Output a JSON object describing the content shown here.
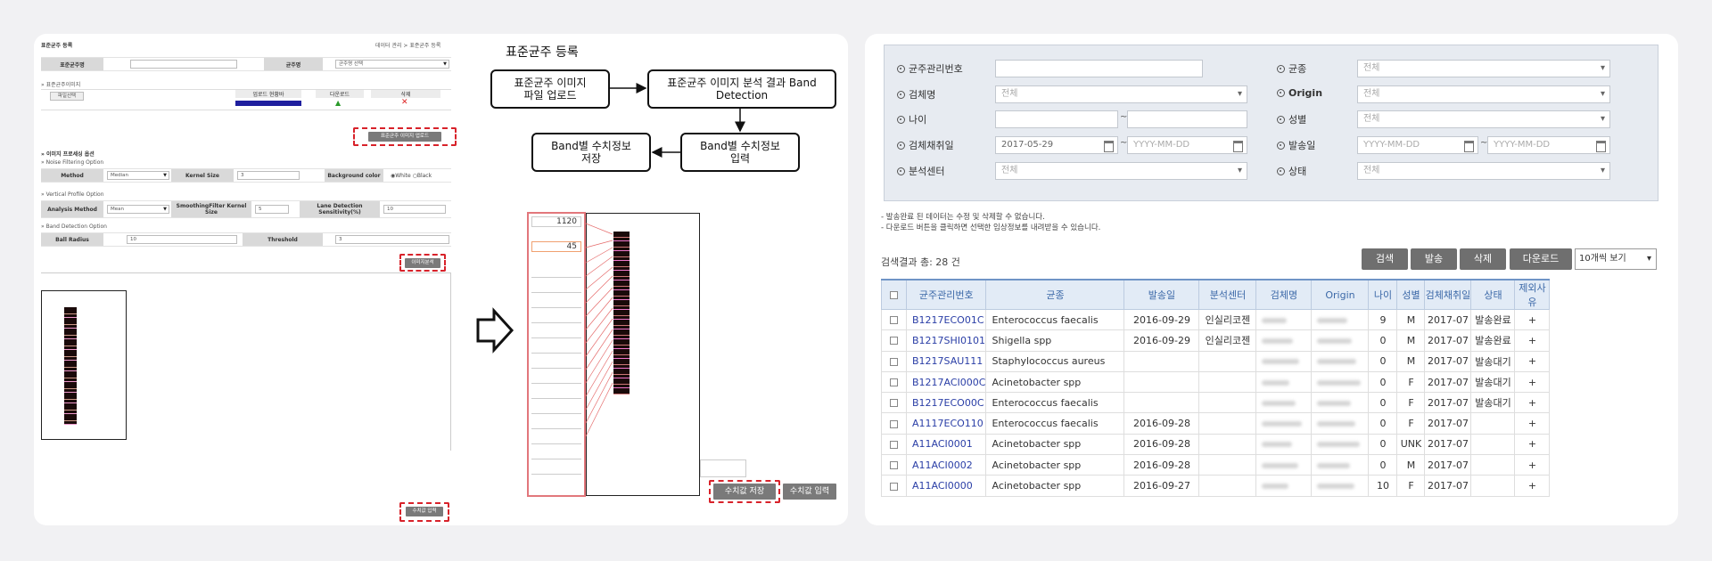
{
  "left_form": {
    "title": "표준균주 등록",
    "breadcrumb": "데이터 관리 > 표준균주 등록",
    "strain_name_label": "표준균주명",
    "strain_label": "균주명",
    "strain_select": "균주명 선택",
    "image_section": "» 표준균주이미지",
    "file_button": "파일선택",
    "cols": {
      "upload_status": "업로드 현황바",
      "download": "다운로드",
      "delete": "삭제"
    },
    "upload_button": "표준균주 이미지 업로드",
    "preprocess_section": "» 이미지 프로세싱 옵션",
    "noise_section": "» Noise Filtering Option",
    "method_label": "Method",
    "method_value": "Median",
    "kernel_label": "Kernel Size",
    "kernel_value": "3",
    "bg_label": "Background color",
    "bg_options": "◉White ○Black",
    "vertical_section": "» Vertical Profile Option",
    "analysis_label": "Analysis Method",
    "analysis_value": "Mean",
    "smoothing_label": "SmoothingFilter Kernel Size",
    "smoothing_value": "5",
    "lane_label": "Lane Detection Sensitivity(%)",
    "lane_value": "10",
    "band_section": "» Band Detection Option",
    "ball_label": "Ball Radius",
    "ball_value": "10",
    "threshold_label": "Threshold",
    "threshold_value": "3",
    "analyze_button": "이미지분석",
    "save_button": "수치값 입력"
  },
  "flow": {
    "title": "표준균주 등록",
    "step1": "표준균주 이미지\n파일 업로드",
    "step2": "표준균주 이미지 분석 결과 Band\nDetection",
    "step3": "Band별 수치정보\n입력",
    "step4": "Band별 수치정보\n저장"
  },
  "band_panel": {
    "value1": "1120",
    "value2": "45",
    "save_button": "수치값 저장",
    "input_button": "수치값 입력"
  },
  "search": {
    "mgmt_no_label": "균주관리번호",
    "species_label": "균종",
    "species_value": "전체",
    "specimen_label": "검체명",
    "specimen_value": "전체",
    "origin_label": "Origin",
    "origin_value": "전체",
    "age_label": "나이",
    "sex_label": "성별",
    "sex_value": "전체",
    "collect_label": "검체채취일",
    "collect_from": "2017-05-29",
    "collect_to": "YYYY-MM-DD",
    "send_label": "발송일",
    "send_from": "YYYY-MM-DD",
    "send_to": "YYYY-MM-DD",
    "center_label": "분석센터",
    "center_value": "전체",
    "status_label": "상태",
    "status_value": "전체",
    "tilde": "~"
  },
  "notes": [
    "- 발송완료 된 데이터는 수정 및 삭제할 수 없습니다.",
    "- 다운로드 버튼을 클릭하면 선택한 임상정보를 내려받을 수 있습니다."
  ],
  "result_count": "검색결과 총: 28 건",
  "actions": {
    "search": "검색",
    "send": "발송",
    "delete": "삭제",
    "download": "다운로드",
    "page_size": "10개씩 보기"
  },
  "table": {
    "headers": [
      "균주관리번호",
      "균종",
      "발송일",
      "분석센터",
      "검체명",
      "Origin",
      "나이",
      "성별",
      "검체채취일",
      "상태",
      "제외사유"
    ],
    "rows": [
      [
        "B1217ECO01C",
        "Enterococcus faecalis",
        "2016-09-29",
        "인실리코젠",
        "9",
        "M",
        "2017-07",
        "발송완료",
        "+"
      ],
      [
        "B1217SHI0101",
        "Shigella spp",
        "2016-09-29",
        "인실리코젠",
        "0",
        "M",
        "2017-07",
        "발송완료",
        "+"
      ],
      [
        "B1217SAU111",
        "Staphylococcus aureus",
        "",
        "",
        "0",
        "M",
        "2017-07",
        "발송대기",
        "+"
      ],
      [
        "B1217ACI000C",
        "Acinetobacter spp",
        "",
        "",
        "0",
        "F",
        "2017-07",
        "발송대기",
        "+"
      ],
      [
        "B1217ECO00C",
        "Enterococcus faecalis",
        "",
        "",
        "0",
        "F",
        "2017-07",
        "발송대기",
        "+"
      ],
      [
        "A1117ECO110",
        "Enterococcus faecalis",
        "2016-09-28",
        "",
        "0",
        "F",
        "2017-07",
        "",
        "+"
      ],
      [
        "A11ACI0001",
        "Acinetobacter spp",
        "2016-09-28",
        "",
        "0",
        "UNK",
        "2017-07",
        "",
        "+"
      ],
      [
        "A11ACI0002",
        "Acinetobacter spp",
        "2016-09-28",
        "",
        "0",
        "M",
        "2017-07",
        "",
        "+"
      ],
      [
        "A11ACI0000",
        "Acinetobacter spp",
        "2016-09-27",
        "",
        "10",
        "F",
        "2017-07",
        "",
        "+"
      ]
    ]
  }
}
